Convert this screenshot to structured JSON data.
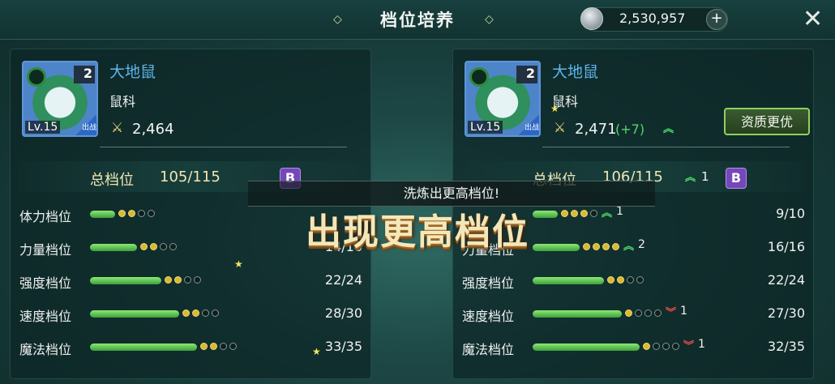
{
  "header": {
    "title": "档位培养",
    "currency": "2,530,957",
    "currency_icon": "silver-coin-icon",
    "plus_label": "+",
    "close_label": "✕"
  },
  "banner": {
    "message": "洗炼出更高档位!",
    "big_text": "出现更高档位"
  },
  "left_panel": {
    "name": "大地鼠",
    "family": "鼠科",
    "level": "Lv.15",
    "stars": "2",
    "tag": "出战",
    "power": "2,464",
    "total_label": "总档位",
    "total_value": "105/115",
    "grade": "B",
    "rows": [
      {
        "label": "体力档位",
        "fill": 0.28,
        "dots_on": 2,
        "dots_total": 4,
        "value": ""
      },
      {
        "label": "力量档位",
        "fill": 0.53,
        "dots_on": 2,
        "dots_total": 4,
        "value": "14/16"
      },
      {
        "label": "强度档位",
        "fill": 0.8,
        "dots_on": 2,
        "dots_total": 4,
        "value": "22/24"
      },
      {
        "label": "速度档位",
        "fill": 1.0,
        "dots_on": 2,
        "dots_total": 4,
        "value": "28/30"
      },
      {
        "label": "魔法档位",
        "fill": 1.2,
        "dots_on": 2,
        "dots_total": 4,
        "value": "33/35"
      }
    ]
  },
  "right_panel": {
    "name": "大地鼠",
    "family": "鼠科",
    "level": "Lv.15",
    "stars": "2",
    "tag": "出战",
    "power": "2,471",
    "power_delta": "(+7)",
    "better_label": "资质更优",
    "total_label": "总档位",
    "total_value": "106/115",
    "total_up": "1",
    "grade": "B",
    "rows": [
      {
        "label": "",
        "fill": 0.28,
        "dots_on": 3,
        "dots_total": 4,
        "trend": "up",
        "delta": "1",
        "value": "9/10"
      },
      {
        "label": "力量档位",
        "fill": 0.53,
        "dots_on": 4,
        "dots_total": 4,
        "trend": "up",
        "delta": "2",
        "value": "16/16"
      },
      {
        "label": "强度档位",
        "fill": 0.8,
        "dots_on": 2,
        "dots_total": 4,
        "trend": "",
        "delta": "",
        "value": "22/24"
      },
      {
        "label": "速度档位",
        "fill": 1.0,
        "dots_on": 1,
        "dots_total": 4,
        "trend": "down",
        "delta": "1",
        "value": "27/30"
      },
      {
        "label": "魔法档位",
        "fill": 1.2,
        "dots_on": 1,
        "dots_total": 4,
        "trend": "down",
        "delta": "1",
        "value": "32/35"
      }
    ]
  },
  "colors": {
    "background": "#1d4846",
    "bar_green": "#5cc651",
    "dot_gold": "#d9b934",
    "grade_purple": "#7448b8",
    "name_blue": "#5fb6ee",
    "up_green": "#4fdb6a",
    "down_red": "#e84a4a"
  }
}
